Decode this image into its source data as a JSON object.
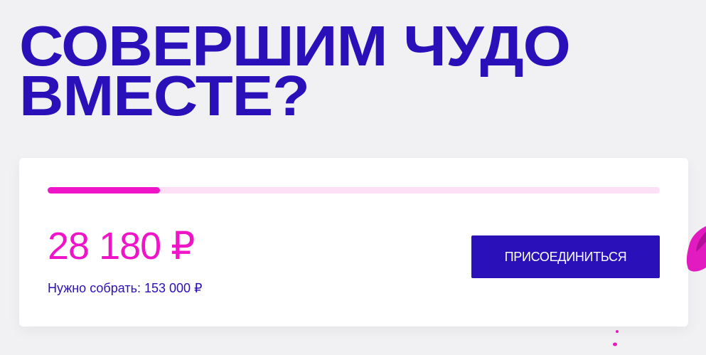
{
  "headline": {
    "line1": "СОВЕРШИМ ЧУДО",
    "line2": "ВМЕСТЕ?"
  },
  "donation": {
    "progress_fraction": 0.184,
    "collected": "28 180 ₽",
    "goal_text": "Нужно собрать: 153 000 ₽",
    "join_label": "ПРИСОЕДИНИТЬСЯ"
  },
  "colors": {
    "brand_blue": "#2a10b8",
    "accent_pink": "#f014c8",
    "progress_track": "#fde0f5",
    "background": "#f1f1f3"
  }
}
